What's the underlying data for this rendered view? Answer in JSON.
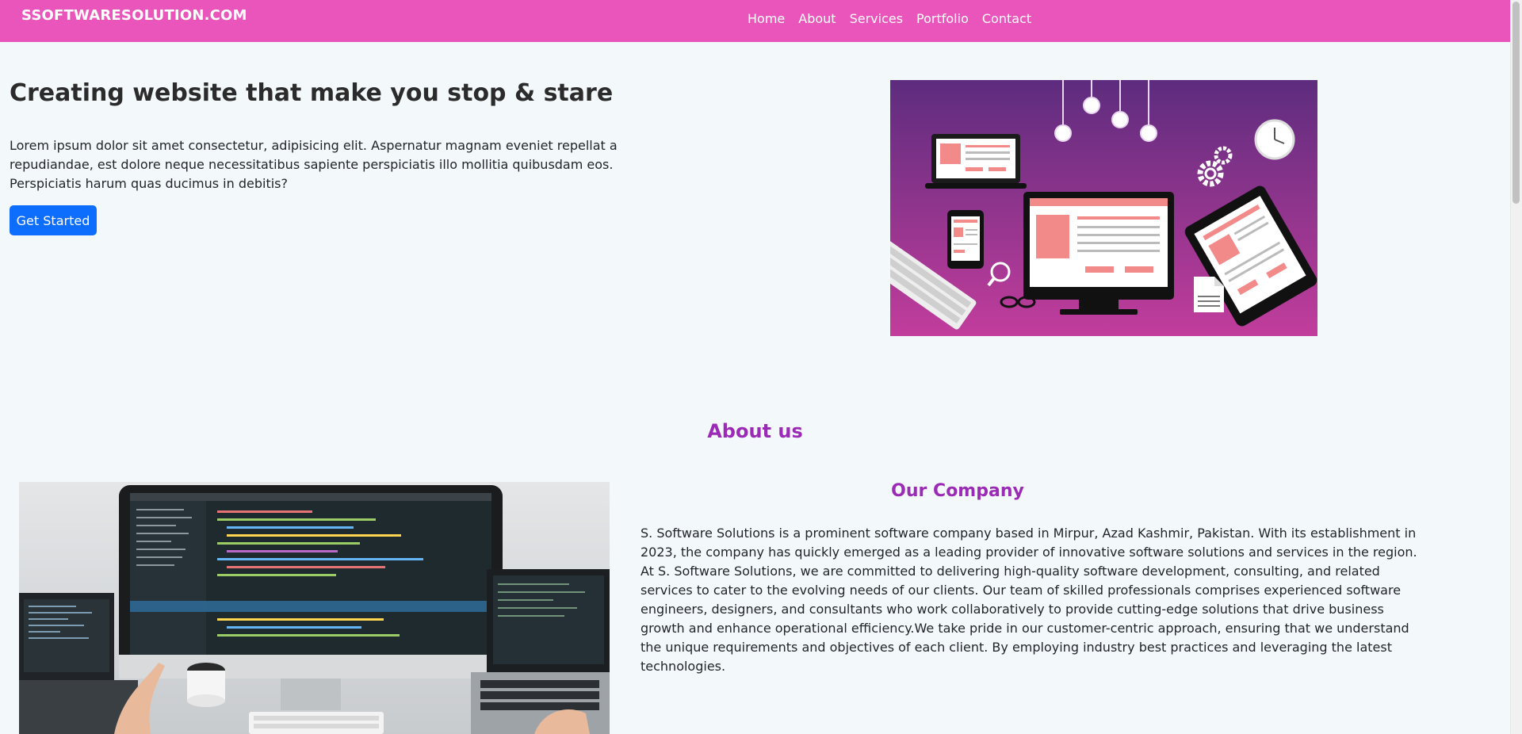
{
  "navbar": {
    "brand": "SSOFTWARESOLUTION.COM",
    "links": [
      "Home",
      "About",
      "Services",
      "Portfolio",
      "Contact"
    ]
  },
  "hero": {
    "title": "Creating website that make you stop & stare",
    "text": "Lorem ipsum dolor sit amet consectetur, adipisicing elit. Aspernatur magnam eveniet repellat a repudiandae, est dolore neque necessitatibus sapiente perspiciatis illo mollitia quibusdam eos. Perspiciatis harum quas ducimus in debitis?",
    "button_label": "Get Started"
  },
  "about": {
    "title": "About us",
    "company_title": "Our Company",
    "company_text": "S. Software Solutions is a prominent software company based in Mirpur, Azad Kashmir, Pakistan. With its establishment in 2023, the company has quickly emerged as a leading provider of innovative software solutions and services in the region. At S. Software Solutions, we are committed to delivering high-quality software development, consulting, and related services to cater to the evolving needs of our clients. Our team of skilled professionals comprises experienced software engineers, designers, and consultants who work collaboratively to provide cutting-edge solutions that drive business growth and enhance operational efficiency.We take pride in our customer-centric approach, ensuring that we understand the unique requirements and objectives of each client. By employing industry best practices and leveraging the latest technologies."
  },
  "colors": {
    "navbar": "#e955ba",
    "accent_heading": "#9b2ab6",
    "primary_button": "#0d6efd",
    "page_background": "#f3f9fb"
  }
}
